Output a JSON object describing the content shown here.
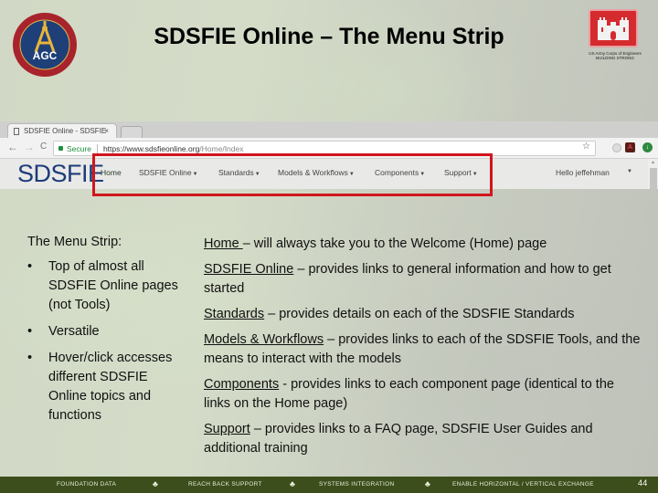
{
  "slide": {
    "title": "SDSFIE Online – The Menu Strip",
    "logos": {
      "left": "AGC",
      "right_caption_line1": "US Army Corps of Engineers",
      "right_caption_line2": "BUILDING STRONG"
    }
  },
  "browser": {
    "tab_title": "SDSFIE Online - SDSFIE",
    "tab_close": "×",
    "back": "←",
    "forward": "→",
    "reload": "C",
    "secure_label": "Secure",
    "url_host": "https://www.sdsfieonline.org",
    "url_path": "/Home/Index",
    "bookmark_icon": "☆",
    "site": {
      "brand": "SDSFIE",
      "menu": [
        {
          "label": "Home",
          "dropdown": false
        },
        {
          "label": "SDSFIE Online",
          "dropdown": true
        },
        {
          "label": "Standards",
          "dropdown": true
        },
        {
          "label": "Models & Workflows",
          "dropdown": true
        },
        {
          "label": "Components",
          "dropdown": true
        },
        {
          "label": "Support",
          "dropdown": true
        }
      ],
      "caret": "▼",
      "user_greeting": "Hello jeffehman",
      "highlight_color": "#d1161c"
    }
  },
  "content": {
    "left_heading": "The Menu Strip:",
    "bullets": [
      "Top of almost all SDSFIE Online pages (not Tools)",
      "Versatile",
      "Hover/click accesses different SDSFIE Online topics and functions"
    ],
    "bullet_char": "•",
    "descriptions": [
      {
        "term": "Home ",
        "text": "– will always take you to the Welcome (Home) page"
      },
      {
        "term": "SDSFIE Online",
        "text": " – provides links to general information and how to get started"
      },
      {
        "term": "Standards",
        "text": " – provides details on each of the SDSFIE Standards"
      },
      {
        "term": "Models & Workflows",
        "text": " – provides links to each of the SDSFIE Tools, and the means to interact with the models"
      },
      {
        "term": "Components",
        "text": " - provides links to each component page (identical to the links on the Home page)"
      },
      {
        "term": "Support",
        "text": " – provides links to a FAQ page, SDSFIE User Guides and additional training"
      }
    ]
  },
  "footer": {
    "items": [
      "FOUNDATION DATA",
      "REACH BACK SUPPORT",
      "SYSTEMS INTEGRATION",
      "ENABLE HORIZONTAL / VERTICAL EXCHANGE"
    ],
    "separator_icon": "♣",
    "page_number": "44",
    "background_color": "#3c4e1b"
  }
}
